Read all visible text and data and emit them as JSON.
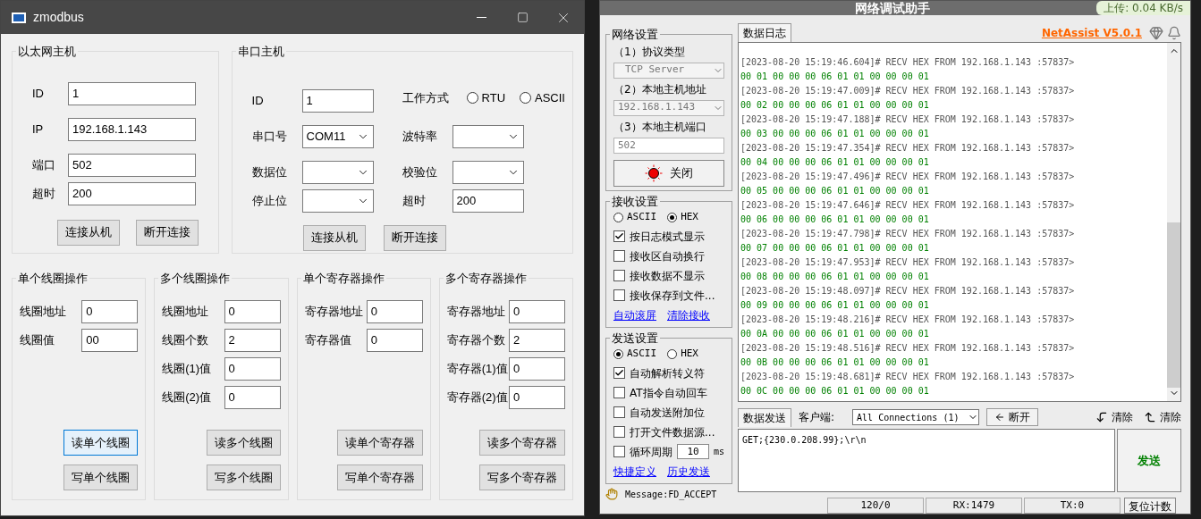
{
  "zmodbus": {
    "title": "zmodbus",
    "ethernet": {
      "title": "以太网主机",
      "fields": [
        {
          "label": "ID",
          "value": "1"
        },
        {
          "label": "IP",
          "value": "192.168.1.143"
        },
        {
          "label": "端口",
          "value": "502"
        },
        {
          "label": "超时",
          "value": "200"
        }
      ],
      "buttons": [
        "连接从机",
        "断开连接"
      ]
    },
    "serial": {
      "title": "串口主机",
      "fields": [
        {
          "kind": "text",
          "label": "ID",
          "value": "1"
        },
        {
          "kind": "radio",
          "label": "工作方式",
          "options": [
            {
              "label": "RTU",
              "selected": false
            },
            {
              "label": "ASCII",
              "selected": false
            }
          ]
        },
        {
          "kind": "select",
          "label": "串口号",
          "value": "COM11"
        },
        {
          "kind": "select",
          "label": "波特率"
        },
        {
          "kind": "select",
          "label": "数据位"
        },
        {
          "kind": "select",
          "label": "校验位"
        },
        {
          "kind": "select",
          "label": "停止位"
        },
        {
          "kind": "text",
          "label": "超时",
          "value": "200"
        }
      ],
      "buttons": [
        "连接从机",
        "断开连接"
      ]
    },
    "operations": [
      {
        "title": "单个线圈操作",
        "fields": [
          {
            "label": "线圈地址",
            "value": "0"
          },
          {
            "label": "线圈值",
            "value": "00"
          }
        ],
        "buttons": [
          {
            "label": "读单个线圈",
            "focused": true
          },
          {
            "label": "写单个线圈",
            "focused": false
          }
        ]
      },
      {
        "title": "多个线圈操作",
        "fields": [
          {
            "label": "线圈地址",
            "value": "0"
          },
          {
            "label": "线圈个数",
            "value": "2"
          },
          {
            "label": "线圈(1)值",
            "value": "0"
          },
          {
            "label": "线圈(2)值",
            "value": "0"
          }
        ],
        "buttons": [
          {
            "label": "读多个线圈",
            "focused": false
          },
          {
            "label": "写多个线圈",
            "focused": false
          }
        ]
      },
      {
        "title": "单个寄存器操作",
        "fields": [
          {
            "label": "寄存器地址",
            "value": "0"
          },
          {
            "label": "寄存器值",
            "value": "0"
          }
        ],
        "buttons": [
          {
            "label": "读单个寄存器",
            "focused": false
          },
          {
            "label": "写单个寄存器",
            "focused": false
          }
        ]
      },
      {
        "title": "多个寄存器操作",
        "fields": [
          {
            "label": "寄存器地址",
            "value": "0"
          },
          {
            "label": "寄存器个数",
            "value": "2"
          },
          {
            "label": "寄存器(1)值",
            "value": "0"
          },
          {
            "label": "寄存器(2)值",
            "value": "0"
          }
        ],
        "buttons": [
          {
            "label": "读多个寄存器",
            "focused": false
          },
          {
            "label": "写多个寄存器",
            "focused": false
          }
        ]
      }
    ]
  },
  "netassist": {
    "title": "网络调试助手",
    "upload": "上传: 0.04 KB/s",
    "network": {
      "title": "网络设置",
      "protocol_label": "（1）协议类型",
      "protocol": "TCP Server",
      "host_label": "（2）本地主机地址",
      "host": "192.168.1.143",
      "port_label": "（3）本地主机端口",
      "port": "502",
      "button": "关闭"
    },
    "receive": {
      "title": "接收设置",
      "modes": [
        {
          "label": "ASCII",
          "selected": false
        },
        {
          "label": "HEX",
          "selected": true
        }
      ],
      "options": [
        {
          "label": "按日志模式显示",
          "checked": true
        },
        {
          "label": "接收区自动换行",
          "checked": false
        },
        {
          "label": "接收数据不显示",
          "checked": false
        },
        {
          "label": "接收保存到文件...",
          "checked": false
        }
      ],
      "links": [
        "自动滚屏",
        "清除接收"
      ]
    },
    "send": {
      "title": "发送设置",
      "modes": [
        {
          "label": "ASCII",
          "selected": true
        },
        {
          "label": "HEX",
          "selected": false
        }
      ],
      "options": [
        {
          "kind": "check",
          "label": "自动解析转义符",
          "checked": true
        },
        {
          "kind": "check",
          "label": "AT指令自动回车",
          "checked": false
        },
        {
          "kind": "check",
          "label": "自动发送附加位",
          "checked": false
        },
        {
          "kind": "check",
          "label": "打开文件数据源...",
          "checked": false
        },
        {
          "kind": "period",
          "label": "循环周期",
          "checked": false,
          "value": "10",
          "unit": "ms"
        }
      ],
      "links": [
        "快捷定义",
        "历史发送"
      ]
    },
    "log": {
      "tab": "数据日志",
      "brand": "NetAssist V5.0.1",
      "entries": [
        {
          "header": "[2023-08-20 15:19:46.604]# RECV HEX FROM 192.168.1.143 :57837>",
          "data": "00 01 00 00 00 06 01 01 00 00 00 01"
        },
        {
          "header": "[2023-08-20 15:19:47.009]# RECV HEX FROM 192.168.1.143 :57837>",
          "data": "00 02 00 00 00 06 01 01 00 00 00 01"
        },
        {
          "header": "[2023-08-20 15:19:47.188]# RECV HEX FROM 192.168.1.143 :57837>",
          "data": "00 03 00 00 00 06 01 01 00 00 00 01"
        },
        {
          "header": "[2023-08-20 15:19:47.354]# RECV HEX FROM 192.168.1.143 :57837>",
          "data": "00 04 00 00 00 06 01 01 00 00 00 01"
        },
        {
          "header": "[2023-08-20 15:19:47.496]# RECV HEX FROM 192.168.1.143 :57837>",
          "data": "00 05 00 00 00 06 01 01 00 00 00 01"
        },
        {
          "header": "[2023-08-20 15:19:47.646]# RECV HEX FROM 192.168.1.143 :57837>",
          "data": "00 06 00 00 00 06 01 01 00 00 00 01"
        },
        {
          "header": "[2023-08-20 15:19:47.798]# RECV HEX FROM 192.168.1.143 :57837>",
          "data": "00 07 00 00 00 06 01 01 00 00 00 01"
        },
        {
          "header": "[2023-08-20 15:19:47.953]# RECV HEX FROM 192.168.1.143 :57837>",
          "data": "00 08 00 00 00 06 01 01 00 00 00 01"
        },
        {
          "header": "[2023-08-20 15:19:48.097]# RECV HEX FROM 192.168.1.143 :57837>",
          "data": "00 09 00 00 00 06 01 01 00 00 00 01"
        },
        {
          "header": "[2023-08-20 15:19:48.216]# RECV HEX FROM 192.168.1.143 :57837>",
          "data": "00 0A 00 00 00 06 01 01 00 00 00 01"
        },
        {
          "header": "[2023-08-20 15:19:48.516]# RECV HEX FROM 192.168.1.143 :57837>",
          "data": "00 0B 00 00 00 06 01 01 00 00 00 01"
        },
        {
          "header": "[2023-08-20 15:19:48.681]# RECV HEX FROM 192.168.1.143 :57837>",
          "data": "00 0C 00 00 00 06 01 01 00 00 00 01"
        }
      ]
    },
    "sender": {
      "tab": "数据发送",
      "client_label": "客户端:",
      "client": "All Connections (1)",
      "disconnect": "断开",
      "clear_buttons": [
        "清除",
        "清除"
      ],
      "text": "GET;{230.0.208.99};\\r\\n",
      "send": "发送"
    },
    "status": {
      "message": "Message:FD_ACCEPT",
      "counts": [
        "120/0",
        "RX:1479",
        "TX:0"
      ],
      "reset": "复位计数"
    }
  }
}
